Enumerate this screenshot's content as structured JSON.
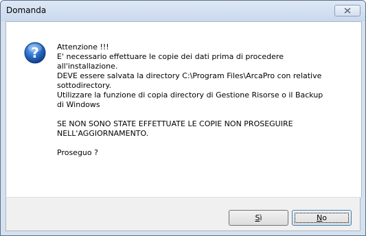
{
  "window": {
    "title": "Domanda",
    "close_icon": "close-icon"
  },
  "dialog": {
    "icon": "question-icon",
    "message_lines": [
      "Attenzione  !!!",
      "E' necessario effettuare le copie dei dati prima di procedere",
      "all'installazione.",
      "DEVE essere salvata la directory C:\\Program Files\\ArcaPro con relative",
      "sottodirectory.",
      "Utilizzare la funzione di copia directory di Gestione Risorse o il Backup",
      "di Windows",
      "",
      "SE NON SONO STATE EFFETTUATE LE COPIE NON PROSEGUIRE",
      "NELL'AGGIORNAMENTO.",
      "",
      "Proseguo ?"
    ]
  },
  "buttons": {
    "yes": {
      "accel": "S",
      "rest": "ì"
    },
    "no": {
      "accel": "N",
      "rest": "o"
    }
  }
}
